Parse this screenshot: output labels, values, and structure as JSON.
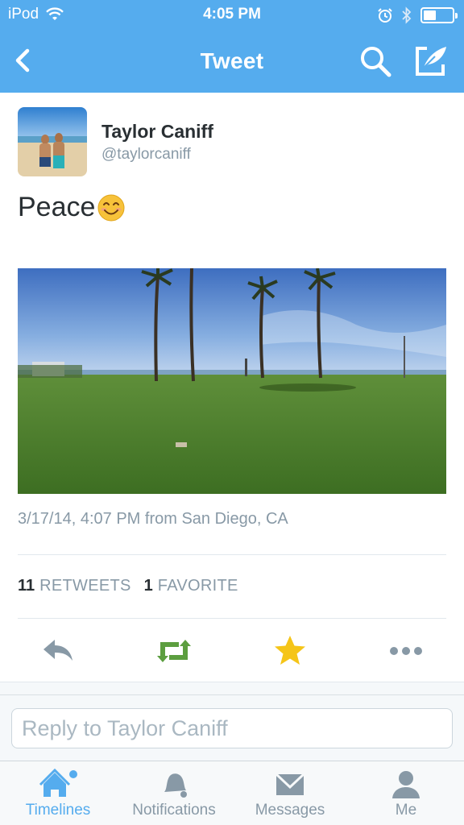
{
  "status_bar": {
    "carrier": "iPod",
    "time": "4:05 PM",
    "battery_fraction": 0.45,
    "icons": [
      "wifi-icon",
      "alarm-icon",
      "bluetooth-icon",
      "battery-icon"
    ]
  },
  "navbar": {
    "title": "Tweet",
    "back_icon": "chevron-left-icon",
    "search_icon": "search-icon",
    "compose_icon": "compose-icon"
  },
  "tweet": {
    "author_name": "Taylor Caniff",
    "author_handle": "@taylorcaniff",
    "text": "Peace",
    "emoji": "smiling-face-emoji",
    "timestamp": "3/17/14, 4:07 PM from San Diego, CA",
    "retweets_count": "11",
    "retweets_label": "RETWEETS",
    "favorites_count": "1",
    "favorites_label": "FAVORITE"
  },
  "actions": [
    {
      "name": "reply",
      "icon": "reply-icon",
      "color": "#8899a6"
    },
    {
      "name": "retweet",
      "icon": "retweet-icon",
      "color": "#5c9e3f"
    },
    {
      "name": "favorite",
      "icon": "star-icon",
      "color": "#f5c518"
    },
    {
      "name": "more",
      "icon": "more-icon",
      "color": "#8899a6"
    }
  ],
  "reply": {
    "placeholder": "Reply to Taylor Caniff"
  },
  "tabs": [
    {
      "label": "Timelines",
      "icon": "home-icon",
      "active": true
    },
    {
      "label": "Notifications",
      "icon": "bell-icon",
      "active": false
    },
    {
      "label": "Messages",
      "icon": "envelope-icon",
      "active": false
    },
    {
      "label": "Me",
      "icon": "person-icon",
      "active": false
    }
  ],
  "colors": {
    "brand": "#55acee",
    "text": "#292f33",
    "muted": "#8899a6",
    "retweet": "#5c9e3f",
    "favorite": "#f5c518"
  }
}
